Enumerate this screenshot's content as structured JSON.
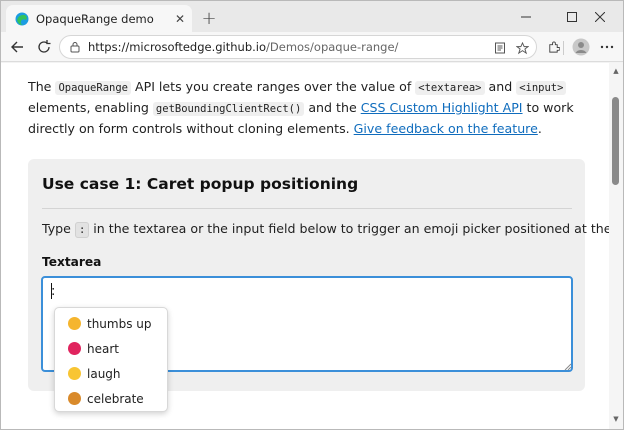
{
  "browser": {
    "tab_title": "OpaqueRange demo",
    "url_host": "https://microsoftedge.github.io",
    "url_path": "/Demos/opaque-range/",
    "accent": "#0f6cbd"
  },
  "intro": {
    "t1": "The ",
    "code1": "OpaqueRange",
    "t2": " API lets you create ranges over the value of ",
    "code2": "<textarea>",
    "t3": " and ",
    "code3": "<input>",
    "t4": " elements, enabling ",
    "code4": "getBoundingClientRect()",
    "t5": " and the ",
    "link1": "CSS Custom Highlight API",
    "t6": " to work directly on form controls without cloning elements. ",
    "link2": "Give feedback on the feature",
    "t7": "."
  },
  "usecase": {
    "title": "Use case 1: Caret popup positioning",
    "desc_before": "Type ",
    "desc_key": ":",
    "desc_after": " in the textarea or the input field below to trigger an emoji picker positioned at the caret.",
    "field_label": "Textarea",
    "textarea_value": ":"
  },
  "emoji_picker": {
    "items": [
      {
        "label": "thumbs up",
        "icon": "thumbs-up-emoji",
        "color": "#f5b52e"
      },
      {
        "label": "heart",
        "icon": "heart-emoji",
        "color": "#e0245e"
      },
      {
        "label": "laugh",
        "icon": "laugh-emoji",
        "color": "#f8c533"
      },
      {
        "label": "celebrate",
        "icon": "party-popper-emoji",
        "color": "#d98a2b"
      }
    ]
  }
}
